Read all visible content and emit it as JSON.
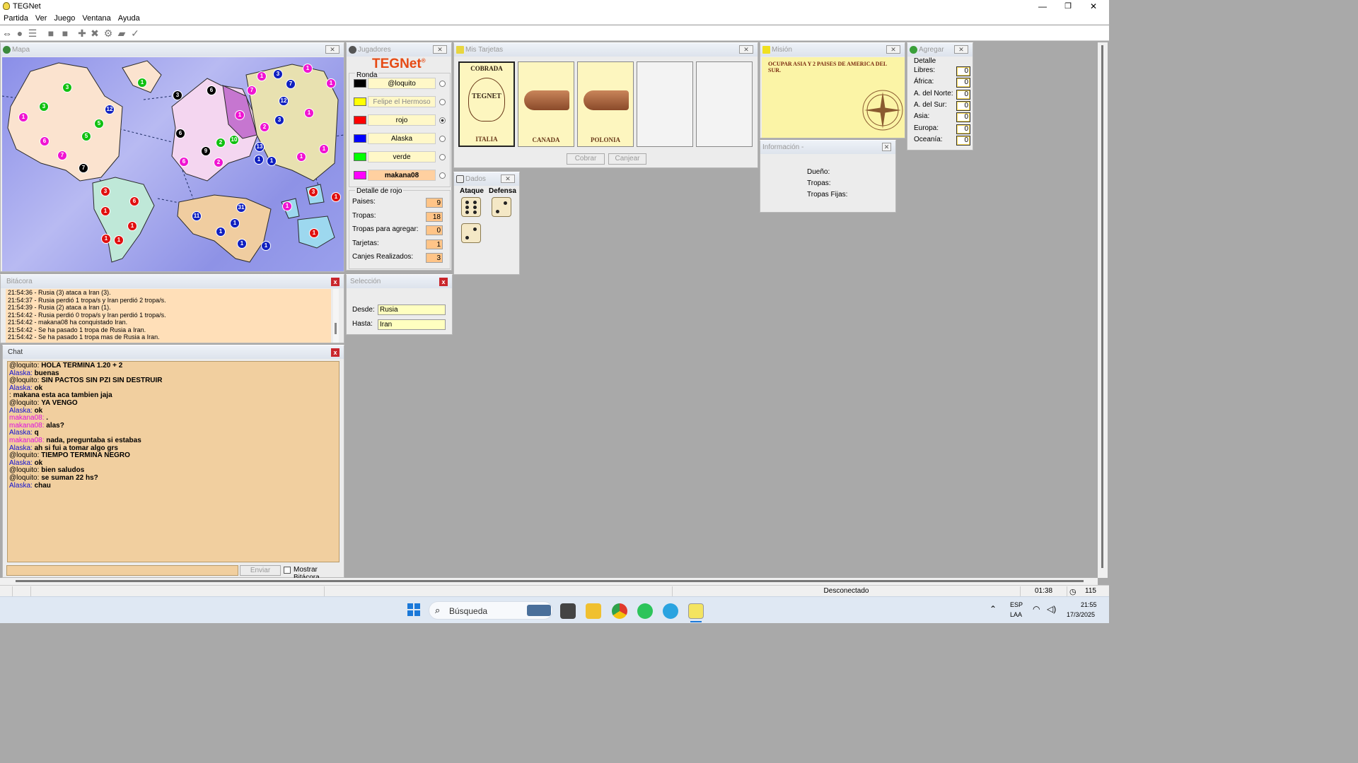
{
  "window": {
    "title": "TEGNet",
    "minimize": "—",
    "maximize": "❐",
    "close": "✕"
  },
  "menu": [
    "Partida",
    "Ver",
    "Juego",
    "Ventana",
    "Ayuda"
  ],
  "map": {
    "title": "Mapa",
    "armies": [
      {
        "n": "1",
        "c": "#f014d2"
      },
      {
        "n": "3",
        "c": "#10c010"
      },
      {
        "n": "3",
        "c": "#10c010"
      },
      {
        "n": "1",
        "c": "#10c010"
      },
      {
        "n": "12",
        "c": "#1020c0"
      },
      {
        "n": "5",
        "c": "#10c010"
      },
      {
        "n": "5",
        "c": "#10c010"
      },
      {
        "n": "6",
        "c": "#f014d2"
      },
      {
        "n": "7",
        "c": "#f014d2"
      },
      {
        "n": "7",
        "c": "#000000"
      },
      {
        "n": "3",
        "c": "#000000"
      },
      {
        "n": "6",
        "c": "#000000"
      },
      {
        "n": "6",
        "c": "#000000"
      },
      {
        "n": "9",
        "c": "#000000"
      },
      {
        "n": "6",
        "c": "#f014d2"
      },
      {
        "n": "2",
        "c": "#f014d2"
      },
      {
        "n": "2",
        "c": "#10c010"
      },
      {
        "n": "10",
        "c": "#10c010"
      },
      {
        "n": "1",
        "c": "#f014d2"
      },
      {
        "n": "13",
        "c": "#1020c0"
      },
      {
        "n": "1",
        "c": "#1020c0"
      },
      {
        "n": "1",
        "c": "#1020c0"
      },
      {
        "n": "1",
        "c": "#f014d2"
      },
      {
        "n": "3",
        "c": "#1020c0"
      },
      {
        "n": "7",
        "c": "#1020c0"
      },
      {
        "n": "7",
        "c": "#f014d2"
      },
      {
        "n": "12",
        "c": "#1020c0"
      },
      {
        "n": "1",
        "c": "#f014d2"
      },
      {
        "n": "1",
        "c": "#f014d2"
      },
      {
        "n": "3",
        "c": "#1020c0"
      },
      {
        "n": "2",
        "c": "#f014d2"
      },
      {
        "n": "1",
        "c": "#f014d2"
      },
      {
        "n": "1",
        "c": "#f014d2"
      },
      {
        "n": "1",
        "c": "#f014d2"
      },
      {
        "n": "3",
        "c": "#e01010"
      },
      {
        "n": "6",
        "c": "#e01010"
      },
      {
        "n": "1",
        "c": "#e01010"
      },
      {
        "n": "1",
        "c": "#e01010"
      },
      {
        "n": "1",
        "c": "#e01010"
      },
      {
        "n": "1",
        "c": "#e01010"
      },
      {
        "n": "11",
        "c": "#1020c0"
      },
      {
        "n": "31",
        "c": "#1020c0"
      },
      {
        "n": "1",
        "c": "#1020c0"
      },
      {
        "n": "1",
        "c": "#1020c0"
      },
      {
        "n": "1",
        "c": "#1020c0"
      },
      {
        "n": "1",
        "c": "#1020c0"
      },
      {
        "n": "1",
        "c": "#f014d2"
      },
      {
        "n": "3",
        "c": "#e01010"
      },
      {
        "n": "1",
        "c": "#e01010"
      },
      {
        "n": "1",
        "c": "#e01010"
      }
    ]
  },
  "players": {
    "title": "Jugadores",
    "logo_a": "TEG",
    "logo_b": "Net",
    "logo_reg": "®",
    "ronda_label": "Ronda",
    "list": [
      {
        "name": "@loquito",
        "color": "#000000",
        "bold": false,
        "gray": false,
        "selected": false
      },
      {
        "name": "Felipe el Hermoso",
        "color": "#ffff00",
        "bold": false,
        "gray": true,
        "selected": false
      },
      {
        "name": "rojo",
        "color": "#ff0000",
        "bold": false,
        "gray": false,
        "selected": true
      },
      {
        "name": "Alaska",
        "color": "#0000ff",
        "bold": false,
        "gray": false,
        "selected": false
      },
      {
        "name": "verde",
        "color": "#00ff00",
        "bold": false,
        "gray": false,
        "selected": false
      },
      {
        "name": "makana08",
        "color": "#ff00ff",
        "bold": true,
        "gray": false,
        "selected": false
      }
    ],
    "detail_title": "Detalle de rojo",
    "detail": [
      {
        "label": "Paises:",
        "value": "9"
      },
      {
        "label": "Tropas:",
        "value": "18"
      },
      {
        "label": "Tropas para agregar:",
        "value": "0"
      },
      {
        "label": "Tarjetas:",
        "value": "1"
      },
      {
        "label": "Canjes Realizados:",
        "value": "3"
      }
    ]
  },
  "cards": {
    "title": "Mis Tarjetas",
    "items": [
      {
        "top": "COBRADA",
        "name": "ITALIA",
        "art": "TEGNET"
      },
      {
        "top": "",
        "name": "CANADA",
        "art": "cannon"
      },
      {
        "top": "",
        "name": "POLONIA",
        "art": "cannon"
      },
      {
        "top": "",
        "name": "",
        "art": ""
      },
      {
        "top": "",
        "name": "",
        "art": ""
      }
    ],
    "cobrar": "Cobrar",
    "canjear": "Canjear"
  },
  "mission": {
    "title": "Misión",
    "text": "OCUPAR ASIA Y 2 PAISES DE AMERICA DEL SUR."
  },
  "info": {
    "title": "Información -",
    "owner": "Dueño:",
    "troops": "Tropas:",
    "fixed": "Tropas Fijas:"
  },
  "agregar": {
    "title": "Agregar",
    "detail": "Detalle",
    "rows": [
      {
        "label": "Libres:",
        "value": "0"
      },
      {
        "label": "África:",
        "value": "0"
      },
      {
        "label": "A. del Norte:",
        "value": "0"
      },
      {
        "label": "A. del Sur:",
        "value": "0"
      },
      {
        "label": "Asia:",
        "value": "0"
      },
      {
        "label": "Europa:",
        "value": "0"
      },
      {
        "label": "Oceanía:",
        "value": "0"
      }
    ]
  },
  "dice": {
    "title": "Dados",
    "attack": "Ataque",
    "defense": "Defensa"
  },
  "log": {
    "title": "Bitácora",
    "lines": [
      "21:54:36 - Rusia (3) ataca a Iran (3).",
      "21:54:37 - Rusia perdió 1 tropa/s y Iran perdió 2 tropa/s.",
      "21:54:39 - Rusia (2) ataca a Iran (1).",
      "21:54:42 - Rusia perdió 0 tropa/s y Iran perdió 1 tropa/s.",
      "21:54:42 - makana08 ha conquistado Iran.",
      "21:54:42 - Se ha pasado 1 tropa de Rusia a Iran.",
      "21:54:42 - Se ha pasado 1 tropa mas de Rusia a Iran."
    ]
  },
  "selection": {
    "title": "Selección",
    "from_label": "Desde:",
    "from": "Rusia",
    "to_label": "Hasta:",
    "to": "Iran"
  },
  "chat": {
    "title": "Chat",
    "send": "Enviar",
    "show_log": "Mostrar Bitácora",
    "messages": [
      {
        "from": "@loquito",
        "color": "#000000",
        "text": "HOLA TERMINA 1.20 + 2",
        "bold": true
      },
      {
        "from": "Alaska",
        "color": "#1010d0",
        "text": "buenas",
        "bold": true
      },
      {
        "from": "@loquito",
        "color": "#000000",
        "text": "SIN PACTOS SIN PZI SIN DESTRUIR",
        "bold": true
      },
      {
        "from": "Alaska",
        "color": "#1010d0",
        "text": "ok",
        "bold": true
      },
      {
        "from": "",
        "color": "#000000",
        "text": "makana esta aca tambien jaja",
        "bold": true
      },
      {
        "from": "@loquito",
        "color": "#000000",
        "text": "YA VENGO",
        "bold": true
      },
      {
        "from": "Alaska",
        "color": "#1010d0",
        "text": "ok",
        "bold": true
      },
      {
        "from": "makana08",
        "color": "#e010e0",
        "text": ".",
        "bold": true
      },
      {
        "from": "makana08",
        "color": "#e010e0",
        "text": "alas?",
        "bold": true
      },
      {
        "from": "Alaska",
        "color": "#1010d0",
        "text": "q",
        "bold": true
      },
      {
        "from": "makana08",
        "color": "#e010e0",
        "text": "nada, preguntaba si estabas",
        "bold": true
      },
      {
        "from": "Alaska",
        "color": "#1010d0",
        "text": "ah si fui a tomar algo grs",
        "bold": true
      },
      {
        "from": "@loquito",
        "color": "#000000",
        "text": "TIEMPO TERMINA NEGRO",
        "bold": true
      },
      {
        "from": "Alaska",
        "color": "#1010d0",
        "text": "ok",
        "bold": true
      },
      {
        "from": "@loquito",
        "color": "#000000",
        "text": "bien saludos",
        "bold": true
      },
      {
        "from": "@loquito",
        "color": "#000000",
        "text": "se suman 22 hs?",
        "bold": true
      },
      {
        "from": "Alaska",
        "color": "#1010d0",
        "text": "chau",
        "bold": true
      }
    ]
  },
  "status": {
    "connection": "Desconectado",
    "time": "01:38",
    "count": "115"
  },
  "taskbar": {
    "search": "Búsqueda",
    "lang1": "ESP",
    "lang2": "LAA",
    "clock": "21:55",
    "date": "17/3/2025"
  }
}
